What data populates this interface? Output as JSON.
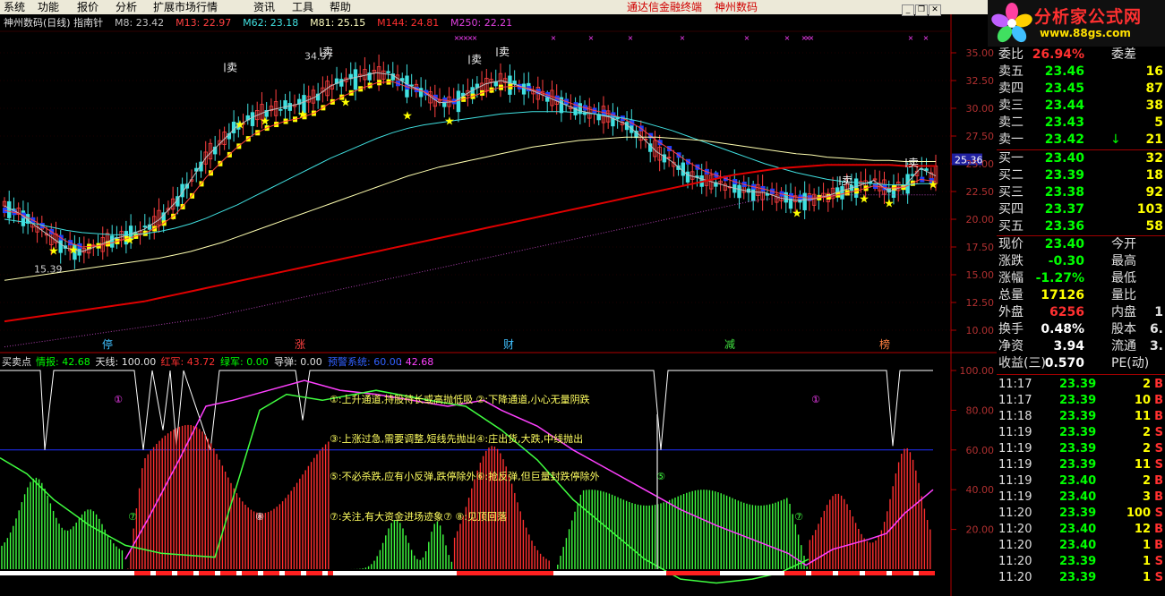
{
  "app": {
    "menu": [
      "系统",
      "功能",
      "报价",
      "分析",
      "扩展市场行情",
      "资讯",
      "工具",
      "帮助"
    ],
    "brand_center": "通达信金融终端",
    "brand_stock": "神州数码",
    "logo_title": "分析家公式网",
    "logo_url": "www.88gs.com"
  },
  "chart_header": {
    "title": "神州数码(日线) 指南针",
    "ma": [
      {
        "label": "M8: 23.42",
        "color": "#c0c0c0"
      },
      {
        "label": "M13: 22.97",
        "color": "#ff4040"
      },
      {
        "label": "M62: 23.18",
        "color": "#40e0e0"
      },
      {
        "label": "M81: 25.15",
        "color": "#ffffc0"
      },
      {
        "label": "M144: 24.81",
        "color": "#ff3030"
      },
      {
        "label": "M250: 22.21",
        "color": "#e040e0"
      }
    ]
  },
  "price_axis": {
    "ticks": [
      "35.00",
      "32.50",
      "30.00",
      "27.50",
      "25.00",
      "22.50",
      "20.00",
      "17.50",
      "15.00",
      "12.50",
      "10.00"
    ],
    "current": "25.36"
  },
  "price_chart": {
    "sell_marks": [
      "卖",
      "卖",
      "卖",
      "卖",
      "卖",
      "卖"
    ],
    "high_label": "34.97",
    "low_label": "15.39",
    "pattern_labels": [
      "停",
      "涨",
      "财",
      "减",
      "榜"
    ]
  },
  "chart_data": {
    "type": "line",
    "title": "神州数码(日线)",
    "ylim": [
      10,
      35
    ],
    "x_days": 200,
    "series": [
      {
        "name": "M8",
        "values": [
          21.2,
          20.5,
          19.4,
          18.4,
          17.4,
          17.1,
          17.6,
          18.2,
          18.6,
          19.1,
          20.0,
          21.5,
          23.5,
          25.6,
          27.0,
          28.4,
          29.2,
          29.8,
          30.1,
          30.4,
          31.0,
          32.0,
          32.6,
          32.9,
          33.2,
          33.0,
          32.1,
          31.5,
          30.5,
          30.6,
          31.5,
          32.2,
          32.5,
          32.1,
          31.6,
          31.0,
          30.4,
          29.8,
          29.5,
          29.2,
          28.6,
          27.5,
          26.1,
          25.2,
          24.0,
          23.6,
          23.2,
          22.8,
          22.5,
          22.4,
          21.9,
          21.7,
          21.8,
          22.1,
          22.6,
          23.0,
          23.5,
          22.5,
          23.0,
          24.6,
          23.9
        ]
      },
      {
        "name": "M13",
        "values": [
          20.8,
          20.5,
          19.8,
          18.9,
          18.0,
          17.5,
          17.6,
          17.9,
          18.3,
          18.7,
          19.4,
          20.4,
          22.0,
          23.8,
          25.2,
          26.5,
          27.6,
          28.3,
          28.8,
          29.1,
          29.6,
          30.5,
          31.2,
          31.8,
          32.3,
          32.4,
          31.9,
          31.5,
          30.8,
          30.6,
          31.0,
          31.5,
          31.9,
          32.0,
          31.7,
          31.2,
          30.7,
          30.2,
          29.8,
          29.5,
          29.0,
          28.2,
          27.1,
          26.2,
          25.2,
          24.4,
          23.9,
          23.4,
          23.0,
          22.7,
          22.3,
          22.0,
          21.9,
          22.0,
          22.3,
          22.6,
          23.0,
          22.8,
          22.9,
          23.6,
          23.4
        ]
      },
      {
        "name": "M62",
        "values": [
          20.0,
          19.8,
          19.6,
          19.3,
          19.0,
          18.8,
          18.7,
          18.6,
          18.6,
          18.7,
          18.9,
          19.2,
          19.6,
          20.1,
          20.7,
          21.3,
          22.0,
          22.7,
          23.4,
          24.1,
          24.8,
          25.5,
          26.1,
          26.7,
          27.3,
          27.8,
          28.2,
          28.5,
          28.7,
          28.9,
          29.1,
          29.3,
          29.5,
          29.6,
          29.7,
          29.7,
          29.7,
          29.6,
          29.5,
          29.3,
          29.1,
          28.8,
          28.4,
          28.0,
          27.5,
          27.0,
          26.5,
          26.0,
          25.5,
          25.0,
          24.6,
          24.2,
          23.9,
          23.6,
          23.4,
          23.3,
          23.2,
          23.1,
          23.1,
          23.2,
          23.2
        ]
      },
      {
        "name": "M81",
        "values": [
          14.5,
          14.7,
          14.9,
          15.1,
          15.3,
          15.5,
          15.7,
          15.9,
          16.1,
          16.3,
          16.5,
          16.8,
          17.1,
          17.5,
          17.9,
          18.4,
          18.9,
          19.4,
          19.9,
          20.4,
          20.9,
          21.4,
          21.9,
          22.4,
          22.9,
          23.4,
          23.9,
          24.3,
          24.7,
          25.0,
          25.3,
          25.6,
          25.9,
          26.2,
          26.5,
          26.7,
          26.9,
          27.1,
          27.2,
          27.3,
          27.4,
          27.4,
          27.4,
          27.3,
          27.2,
          27.1,
          26.9,
          26.7,
          26.5,
          26.3,
          26.1,
          25.9,
          25.8,
          25.6,
          25.5,
          25.4,
          25.3,
          25.3,
          25.2,
          25.2,
          25.2
        ]
      },
      {
        "name": "M144",
        "values": [
          10.8,
          11.0,
          11.2,
          11.4,
          11.6,
          11.8,
          12.0,
          12.2,
          12.4,
          12.6,
          12.9,
          13.2,
          13.5,
          13.8,
          14.1,
          14.4,
          14.7,
          15.0,
          15.3,
          15.6,
          15.9,
          16.2,
          16.5,
          16.8,
          17.1,
          17.4,
          17.7,
          18.0,
          18.3,
          18.6,
          18.9,
          19.2,
          19.5,
          19.8,
          20.1,
          20.4,
          20.7,
          21.0,
          21.3,
          21.6,
          21.9,
          22.2,
          22.5,
          22.8,
          23.1,
          23.4,
          23.7,
          24.0,
          24.2,
          24.4,
          24.6,
          24.7,
          24.8,
          24.9,
          24.9,
          24.9,
          24.9,
          24.9,
          24.8,
          24.8,
          24.8
        ]
      },
      {
        "name": "M250",
        "values": [
          8.5,
          8.7,
          8.9,
          9.1,
          9.3,
          9.5,
          9.7,
          9.9,
          10.1,
          10.3,
          10.5,
          10.7,
          10.9,
          11.1,
          11.4,
          11.7,
          12.0,
          12.3,
          12.6,
          12.9,
          13.2,
          13.5,
          13.8,
          14.1,
          14.4,
          14.7,
          15.0,
          15.3,
          15.6,
          15.9,
          16.2,
          16.5,
          16.8,
          17.1,
          17.4,
          17.7,
          18.0,
          18.3,
          18.6,
          18.9,
          19.2,
          19.5,
          19.8,
          20.1,
          20.4,
          20.7,
          21.0,
          21.3,
          21.6,
          21.8,
          21.9,
          22.0,
          22.1,
          22.1,
          22.2,
          22.2,
          22.2,
          22.2,
          22.2,
          22.2,
          22.2
        ]
      }
    ],
    "oscillator": {
      "title": "买卖点",
      "ylim": [
        0,
        105
      ],
      "ticks": [
        "100.00",
        "80.00",
        "60.00",
        "40.00",
        "20.00"
      ],
      "values": {
        "情报": "42.68",
        "天线": "100.00",
        "红军": "43.72",
        "绿军": "0.00",
        "导弹": "0.00",
        "预警系统": "60.00"
      }
    }
  },
  "indicator_header": {
    "name": "买卖点",
    "items": [
      {
        "label": "情报: 42.68",
        "color": "#00ff00"
      },
      {
        "label": "天线: 100.00",
        "color": "#e0e0e0"
      },
      {
        "label": "红军: 43.72",
        "color": "#ff3030"
      },
      {
        "label": "绿军: 0.00",
        "color": "#00ff00"
      },
      {
        "label": "导弹: 0.00",
        "color": "#e0e0e0"
      },
      {
        "label": "预警系统: 60.00",
        "color": "#3060ff"
      },
      {
        "label": ": 42.68",
        "color": "#ff40ff"
      }
    ]
  },
  "indicator_notes": [
    "①:上升通道,持股待长或高抛低吸 ②:下降通道,小心无量阴跌",
    "③:上涨过急,需要调整,短线先抛出④:庄出货,大跌,中线抛出",
    "⑤:不必杀跌,应有小反弹,跌停除外⑥:抢反弹,但巨量封跌停除外",
    "⑦:关注,有大资金进场迹象⑦    ⑧:见顶回落"
  ],
  "indicator_marks": [
    "①",
    "①",
    "⑦",
    "⑧",
    "⑤",
    "⑦"
  ],
  "quote": {
    "top_partial": {
      "label": "委比",
      "value": "26.94%",
      "label2": "委差"
    },
    "asks": [
      {
        "label": "卖五",
        "price": "23.46",
        "vol": "16"
      },
      {
        "label": "卖四",
        "price": "23.45",
        "vol": "87"
      },
      {
        "label": "卖三",
        "price": "23.44",
        "vol": "38"
      },
      {
        "label": "卖二",
        "price": "23.43",
        "vol": "5"
      },
      {
        "label": "卖一",
        "price": "23.42",
        "vol": "21",
        "arrow": "↓"
      }
    ],
    "bids": [
      {
        "label": "买一",
        "price": "23.40",
        "vol": "32"
      },
      {
        "label": "买二",
        "price": "23.39",
        "vol": "18"
      },
      {
        "label": "买三",
        "price": "23.38",
        "vol": "92"
      },
      {
        "label": "买四",
        "price": "23.37",
        "vol": "103"
      },
      {
        "label": "买五",
        "price": "23.36",
        "vol": "58"
      }
    ],
    "stats": [
      {
        "l": "现价",
        "v": "23.40",
        "vc": "grn",
        "l2": "今开",
        "v2": ""
      },
      {
        "l": "涨跌",
        "v": "-0.30",
        "vc": "grn",
        "l2": "最高",
        "v2": ""
      },
      {
        "l": "涨幅",
        "v": "-1.27%",
        "vc": "grn",
        "l2": "最低",
        "v2": ""
      },
      {
        "l": "总量",
        "v": "17126",
        "vc": "yel",
        "l2": "量比",
        "v2": ""
      },
      {
        "l": "外盘",
        "v": "6256",
        "vc": "red",
        "l2": "内盘",
        "v2": "1"
      },
      {
        "l": "换手",
        "v": "0.48%",
        "vc": "wht",
        "l2": "股本",
        "v2": "6."
      },
      {
        "l": "净资",
        "v": "3.94",
        "vc": "wht",
        "l2": "流通",
        "v2": "3."
      },
      {
        "l": "收益(三)",
        "v": "0.570",
        "vc": "wht",
        "l2": "PE(动)",
        "v2": ""
      }
    ],
    "ticks": [
      {
        "t": "11:17",
        "p": "23.39",
        "v": "2",
        "s": "B"
      },
      {
        "t": "11:17",
        "p": "23.39",
        "v": "10",
        "s": "B"
      },
      {
        "t": "11:18",
        "p": "23.39",
        "v": "11",
        "s": "B"
      },
      {
        "t": "11:19",
        "p": "23.39",
        "v": "2",
        "s": "S"
      },
      {
        "t": "11:19",
        "p": "23.39",
        "v": "2",
        "s": "S"
      },
      {
        "t": "11:19",
        "p": "23.39",
        "v": "11",
        "s": "S"
      },
      {
        "t": "11:19",
        "p": "23.40",
        "v": "2",
        "s": "B"
      },
      {
        "t": "11:19",
        "p": "23.40",
        "v": "3",
        "s": "B"
      },
      {
        "t": "11:20",
        "p": "23.39",
        "v": "100",
        "s": "S"
      },
      {
        "t": "11:20",
        "p": "23.40",
        "v": "12",
        "s": "B"
      },
      {
        "t": "11:20",
        "p": "23.40",
        "v": "1",
        "s": "B"
      },
      {
        "t": "11:20",
        "p": "23.39",
        "v": "1",
        "s": "S"
      },
      {
        "t": "11:20",
        "p": "23.39",
        "v": "1",
        "s": "S"
      }
    ]
  }
}
